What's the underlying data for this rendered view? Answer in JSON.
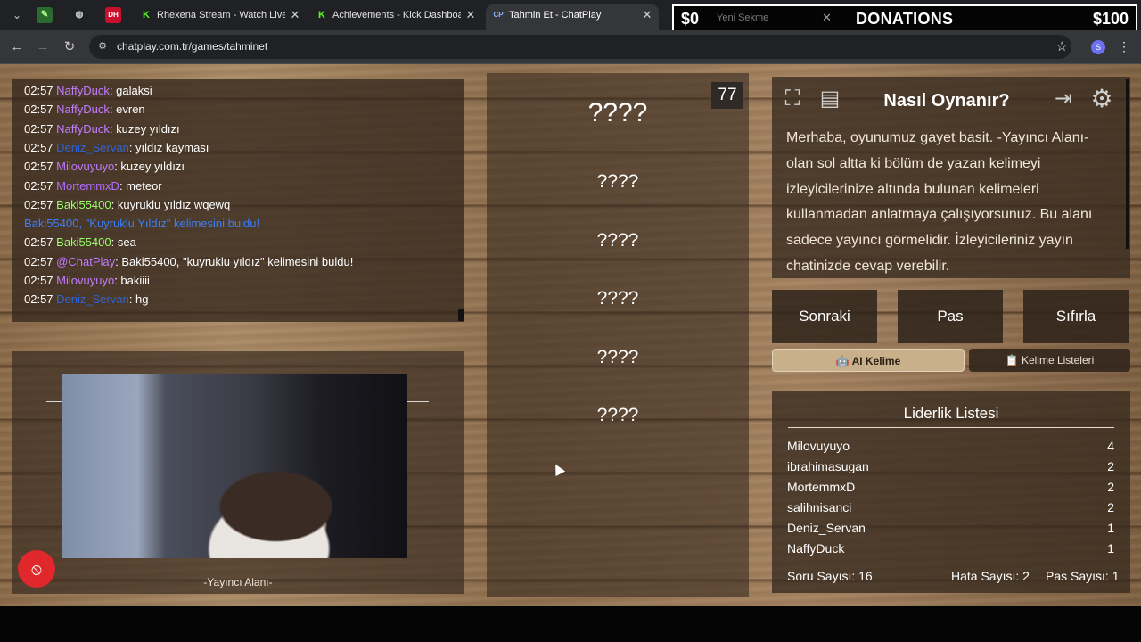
{
  "browser": {
    "tabs": [
      {
        "title": "Rhexena Stream - Watch Live o",
        "favicon": "K"
      },
      {
        "title": "Achievements - Kick Dashboard",
        "favicon": "K"
      },
      {
        "title": "Tahmin Et - ChatPlay",
        "favicon": "CP",
        "active": true
      },
      {
        "title": "Yeni Sekme",
        "favicon": ""
      }
    ],
    "mini_tabs": [
      "",
      "",
      "DH"
    ],
    "url": "chatplay.com.tr/games/tahminet",
    "profile_initial": "S"
  },
  "donations": {
    "current": "$0",
    "label": "DONATIONS",
    "goal": "$100"
  },
  "chat": {
    "messages": [
      {
        "time": "02:57",
        "user": "NaffyDuck",
        "color": "#c27bff",
        "text": ": galaksi"
      },
      {
        "time": "02:57",
        "user": "NaffyDuck",
        "color": "#c27bff",
        "text": ": evren"
      },
      {
        "time": "02:57",
        "user": "NaffyDuck",
        "color": "#c27bff",
        "text": ": kuzey yıldızı"
      },
      {
        "time": "02:57",
        "user": "Deniz_Servan",
        "color": "#2f63d9",
        "text": ": yıldız kayması"
      },
      {
        "time": "02:57",
        "user": "Milovuyuyo",
        "color": "#c27bff",
        "text": ": kuzey yıldızı"
      },
      {
        "time": "02:57",
        "user": "MortemmxD",
        "color": "#b36cff",
        "text": ": meteor"
      },
      {
        "time": "02:57",
        "user": "Baki55400",
        "color": "#9bff6b",
        "text": ": kuyruklu yıldız wqewq"
      },
      {
        "time": "",
        "user": "Baki55400, \"Kuyruklu Yıldız\" kelimesini buldu!",
        "color": "#3d7ef5",
        "text": ""
      },
      {
        "time": "02:57",
        "user": "Baki55400",
        "color": "#9bff6b",
        "text": ": sea"
      },
      {
        "time": "02:57",
        "user": "@ChatPlay",
        "color": "#c27bff",
        "text": ": Baki55400, \"kuyruklu yıldız\" kelimesini buldu!"
      },
      {
        "time": "02:57",
        "user": "Milovuyuyo",
        "color": "#c27bff",
        "text": ": bakiiii"
      },
      {
        "time": "02:57",
        "user": "Deniz_Servan",
        "color": "#2f63d9",
        "text": ": hg"
      }
    ]
  },
  "streamer": {
    "label": "-Yayıncı Alanı-"
  },
  "game": {
    "timer": "77",
    "slots": [
      "????",
      "????",
      "????",
      "????",
      "????",
      "????"
    ]
  },
  "howto": {
    "title": "Nasıl Oynanır?",
    "text": "Merhaba, oyunumuz gayet basit. -Yayıncı Alanı- olan sol altta ki bölüm de yazan kelimeyi izleyicilerinize altında bulunan kelimeleri kullanmadan anlatmaya çalışıyorsunuz. Bu alanı sadece yayıncı görmelidir. İzleyicileriniz yayın chatinizde cevap verebilir."
  },
  "actions": {
    "next": "Sonraki",
    "pass": "Pas",
    "reset": "Sıfırla"
  },
  "word_tabs": {
    "ai": "🤖 AI Kelime",
    "lists": "📋 Kelime Listeleri"
  },
  "leaderboard": {
    "title": "Liderlik Listesi",
    "rows": [
      {
        "name": "Milovuyuyo",
        "score": "4"
      },
      {
        "name": "ibrahimasugan",
        "score": "2"
      },
      {
        "name": "MortemmxD",
        "score": "2"
      },
      {
        "name": "salihnisanci",
        "score": "2"
      },
      {
        "name": "Deniz_Servan",
        "score": "1"
      },
      {
        "name": "NaffyDuck",
        "score": "1"
      }
    ],
    "stats": {
      "questions": "Soru Sayısı: 16",
      "errors": "Hata Sayısı: 2",
      "passes": "Pas Sayısı: 1"
    }
  }
}
